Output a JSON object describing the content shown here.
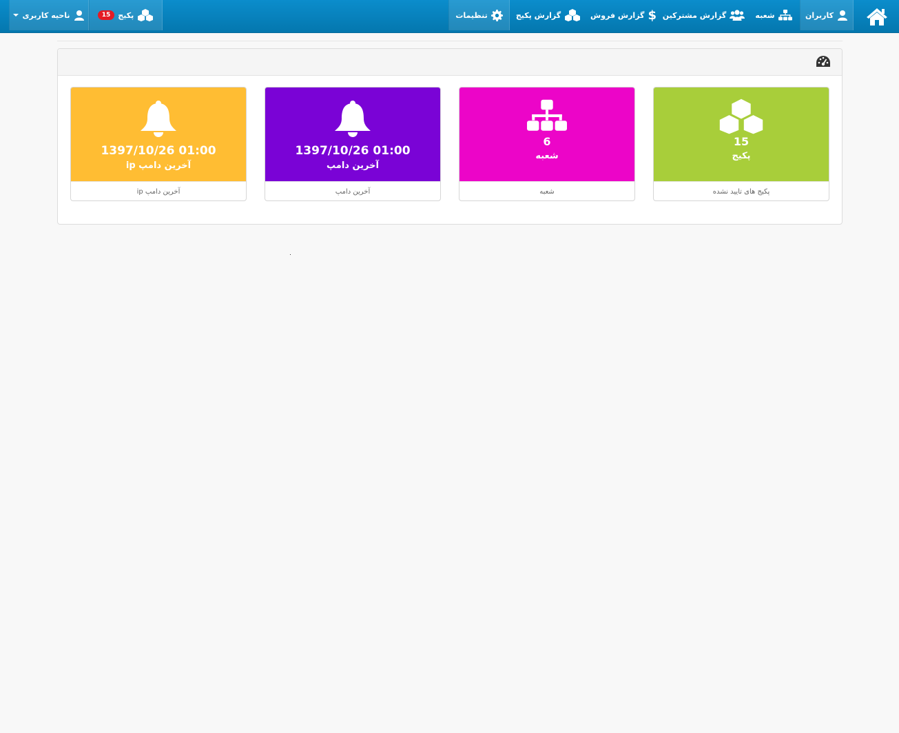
{
  "colors": {
    "navbar": "#0a84c1",
    "card_green": "#a8ce3a",
    "card_magenta": "#ec05c8",
    "card_purple": "#7a03d6",
    "card_yellow": "#ffbd33",
    "badge": "#e51b24"
  },
  "navbar": {
    "home_icon": "home-icon",
    "items": [
      {
        "label": "کاربران",
        "icon": "user-icon"
      },
      {
        "label": "شعبه",
        "icon": "sitemap-icon"
      },
      {
        "label": "گزارش مشترکین",
        "icon": "users-icon"
      },
      {
        "label": "گزارش فروش",
        "icon": "dollar-icon"
      },
      {
        "label": "گزارش پکیج",
        "icon": "cubes-icon"
      },
      {
        "label": "تنظیمات",
        "icon": "gear-icon"
      }
    ],
    "package": {
      "label": "پکیج",
      "badge": "15",
      "icon": "cubes-icon"
    },
    "user_area": {
      "label": "ناحیه کاربری",
      "icon": "user-icon"
    }
  },
  "panel": {
    "header_icon": "dashboard-icon",
    "cards": [
      {
        "value": "15",
        "label": "پکیج",
        "footer": "پکیج های تایید نشده",
        "icon": "cubes-icon"
      },
      {
        "value": "6",
        "label": "شعبه",
        "footer": "شعبه",
        "icon": "sitemap-icon"
      },
      {
        "value": "1397/10/26 01:00",
        "label": "آخرین دامپ",
        "footer": "آخرین دامپ",
        "icon": "bell-icon"
      },
      {
        "value": "1397/10/26 01:00",
        "label": "آخرین دامپ ip",
        "footer": "آخرین دامپ ip",
        "icon": "bell-icon"
      }
    ]
  }
}
